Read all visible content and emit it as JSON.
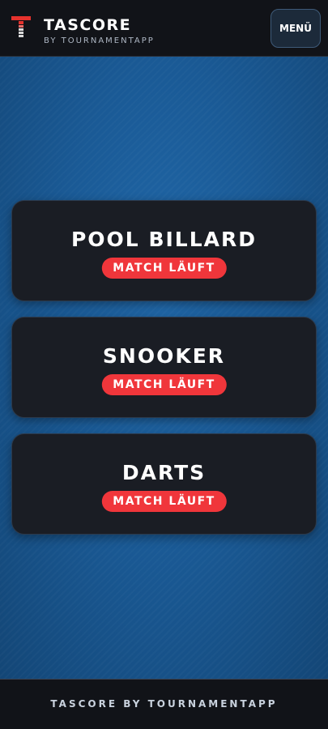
{
  "header": {
    "logo_icon": "tascore-t-logo-icon",
    "title": "TASCORE",
    "subtitle": "BY TOURNAMENTAPP",
    "menu_label": "MENÜ"
  },
  "games": [
    {
      "title": "POOL BILLARD",
      "status": "MATCH LÄUFT"
    },
    {
      "title": "SNOOKER",
      "status": "MATCH LÄUFT"
    },
    {
      "title": "DARTS",
      "status": "MATCH LÄUFT"
    }
  ],
  "footer": {
    "text": "TASCORE BY TOURNAMENTAPP"
  },
  "colors": {
    "accent": "#f0363b",
    "card": "#1a1d24",
    "background_blue": "#1a5a96",
    "header": "#111318"
  }
}
